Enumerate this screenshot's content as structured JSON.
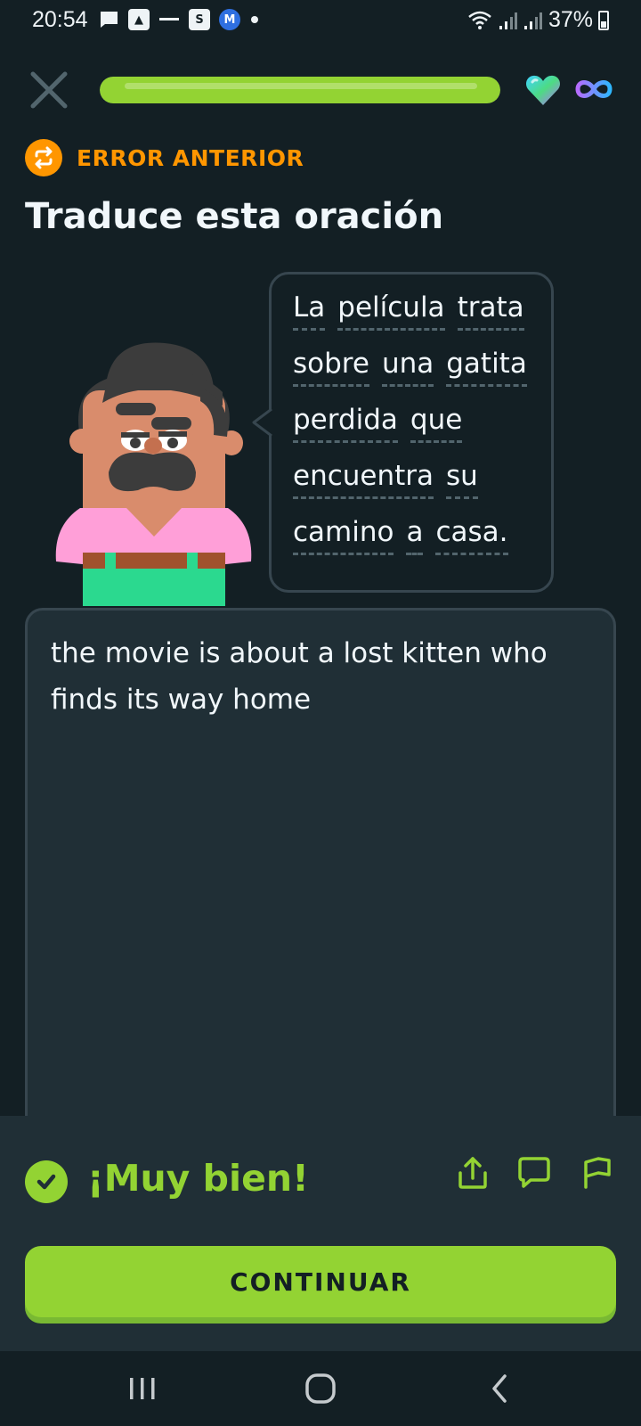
{
  "status_bar": {
    "time": "20:54",
    "battery": "37%"
  },
  "lesson": {
    "progress_fraction": 1.0,
    "hearts": "infinite"
  },
  "header": {
    "previous_mistake_label": "ERROR ANTERIOR",
    "instruction": "Traduce esta oración"
  },
  "prompt": {
    "lines": [
      [
        "La",
        "película",
        "trata"
      ],
      [
        "sobre",
        "una",
        "gatita"
      ],
      [
        "perdida",
        "que"
      ],
      [
        "encuentra",
        "su"
      ],
      [
        "camino",
        "a",
        "casa."
      ]
    ]
  },
  "answer": {
    "text": "the movie is about a lost kitten who finds its way home"
  },
  "feedback": {
    "title": "¡Muy bien!",
    "continue_label": "CONTINUAR"
  },
  "colors": {
    "background": "#131f24",
    "accent_green": "#93d333",
    "orange": "#ff9600",
    "panel": "#202f36"
  }
}
